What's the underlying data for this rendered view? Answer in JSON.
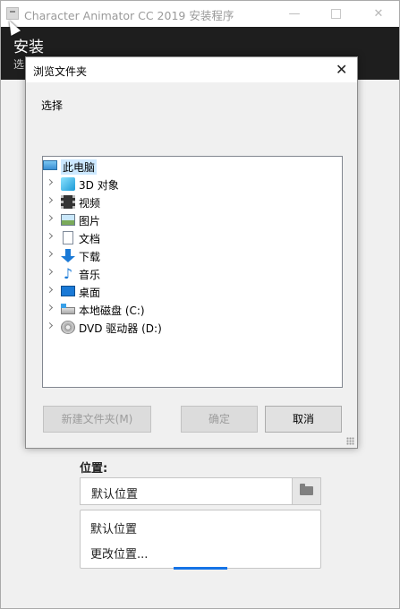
{
  "window": {
    "title": "Character Animator CC 2019 安装程序",
    "minimize": "—",
    "close": "✕"
  },
  "header": {
    "title": "安装",
    "subtitle": "选"
  },
  "location": {
    "label": "位置:",
    "value": "默认位置",
    "options": [
      "默认位置",
      "更改位置..."
    ]
  },
  "dialog": {
    "title": "浏览文件夹",
    "close": "✕",
    "prompt": "选择",
    "tree": [
      {
        "label": "此电脑",
        "icon": "computer-icon",
        "root": true,
        "selected": true
      },
      {
        "label": "3D 对象",
        "icon": "3d-objects-icon"
      },
      {
        "label": "视频",
        "icon": "video-icon"
      },
      {
        "label": "图片",
        "icon": "pictures-icon"
      },
      {
        "label": "文档",
        "icon": "documents-icon"
      },
      {
        "label": "下载",
        "icon": "download-icon"
      },
      {
        "label": "音乐",
        "icon": "music-icon"
      },
      {
        "label": "桌面",
        "icon": "desktop-icon"
      },
      {
        "label": "本地磁盘 (C:)",
        "icon": "local-disk-icon"
      },
      {
        "label": "DVD 驱动器 (D:)",
        "icon": "dvd-drive-icon"
      }
    ],
    "buttons": {
      "new_folder": "新建文件夹(M)",
      "ok": "确定",
      "cancel": "取消"
    }
  },
  "colors": {
    "header_bg": "#1e1e1e",
    "selection": "#cce8ff",
    "accent": "#1473e6"
  }
}
